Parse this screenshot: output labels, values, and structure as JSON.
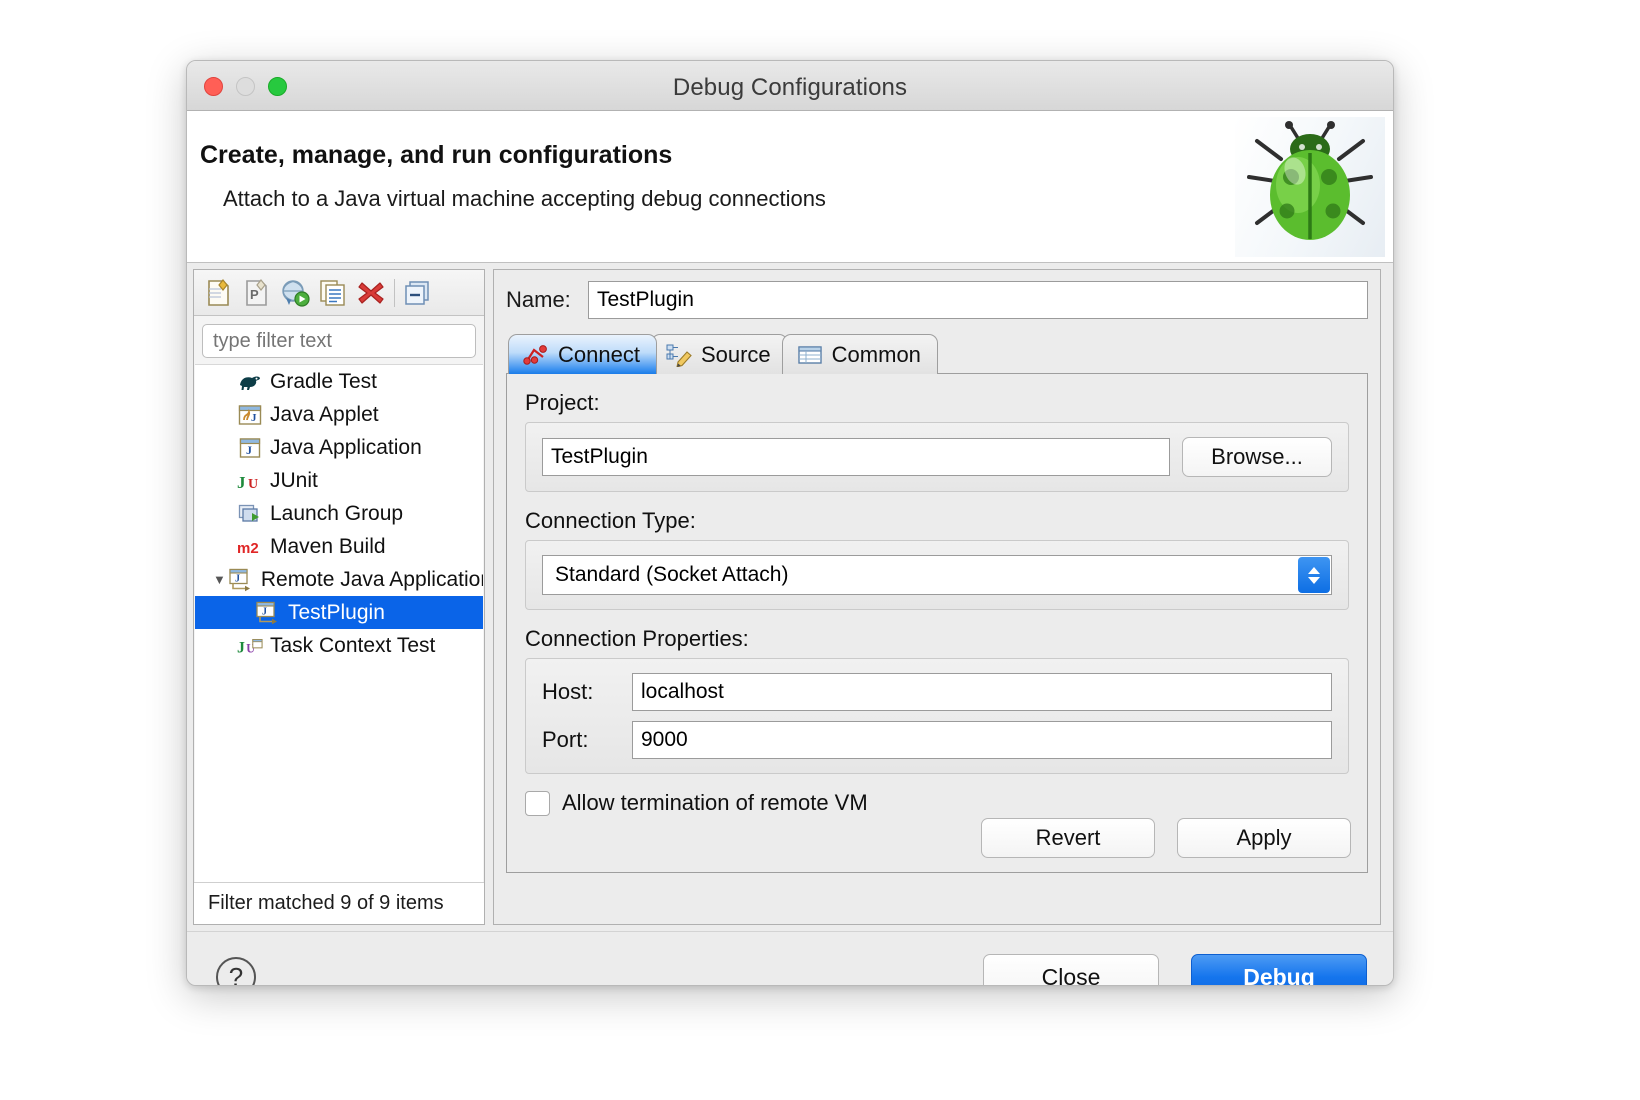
{
  "window": {
    "title": "Debug Configurations",
    "traffic_lights": [
      "close-red",
      "minimize-gray",
      "zoom-green"
    ]
  },
  "header": {
    "title": "Create, manage, and run configurations",
    "subtitle": "Attach to a Java virtual machine accepting debug connections",
    "icon": "ladybug-debug-icon",
    "accent_green": "#4aa82c"
  },
  "left_panel": {
    "toolbar": [
      {
        "name": "new-configuration-icon",
        "tooltip": "New launch configuration"
      },
      {
        "name": "new-prototype-icon",
        "tooltip": "New prototype"
      },
      {
        "name": "export-launch-icon",
        "tooltip": "Export"
      },
      {
        "name": "duplicate-icon",
        "tooltip": "Duplicate"
      },
      {
        "name": "delete-icon",
        "tooltip": "Delete"
      },
      {
        "name": "collapse-all-icon",
        "tooltip": "Collapse All"
      }
    ],
    "filter": {
      "placeholder": "type filter text",
      "value": ""
    },
    "tree": [
      {
        "label": "Gradle Test",
        "icon": "gradle-elephant-icon",
        "indent": 0,
        "expandable": false,
        "selected": false
      },
      {
        "label": "Java Applet",
        "icon": "java-applet-icon",
        "indent": 0,
        "expandable": false,
        "selected": false
      },
      {
        "label": "Java Application",
        "icon": "java-application-icon",
        "indent": 0,
        "expandable": false,
        "selected": false
      },
      {
        "label": "JUnit",
        "icon": "junit-icon",
        "indent": 0,
        "expandable": false,
        "selected": false
      },
      {
        "label": "Launch Group",
        "icon": "launch-group-icon",
        "indent": 0,
        "expandable": false,
        "selected": false
      },
      {
        "label": "Maven Build",
        "icon": "maven-m2-icon",
        "indent": 0,
        "expandable": false,
        "selected": false
      },
      {
        "label": "Remote Java Application",
        "icon": "remote-java-application-icon",
        "indent": 0,
        "expandable": true,
        "expanded": true,
        "selected": false
      },
      {
        "label": "TestPlugin",
        "icon": "remote-java-application-icon",
        "indent": 1,
        "expandable": false,
        "selected": true
      },
      {
        "label": "Task Context Test",
        "icon": "junit-task-context-icon",
        "indent": 0,
        "expandable": false,
        "selected": false
      }
    ],
    "status": "Filter matched 9 of 9 items",
    "selection_color": "#0a64e8"
  },
  "right_panel": {
    "name_label": "Name:",
    "name_value": "TestPlugin",
    "tabs": [
      {
        "label": "Connect",
        "icon": "connect-icon",
        "selected": true
      },
      {
        "label": "Source",
        "icon": "source-pencil-icon",
        "selected": false
      },
      {
        "label": "Common",
        "icon": "common-table-icon",
        "selected": false
      }
    ],
    "project": {
      "label": "Project:",
      "value": "TestPlugin",
      "browse_label": "Browse..."
    },
    "connection_type": {
      "label": "Connection Type:",
      "value": "Standard (Socket Attach)",
      "options": [
        "Standard (Socket Attach)"
      ]
    },
    "connection_properties": {
      "label": "Connection Properties:",
      "host_label": "Host:",
      "host_value": "localhost",
      "port_label": "Port:",
      "port_value": "9000"
    },
    "allow_termination": {
      "label": "Allow termination of remote VM",
      "checked": false
    },
    "revert_label": "Revert",
    "apply_label": "Apply"
  },
  "footer": {
    "help_icon": "?",
    "close_label": "Close",
    "debug_label": "Debug",
    "debug_accent": "#1575ed"
  }
}
